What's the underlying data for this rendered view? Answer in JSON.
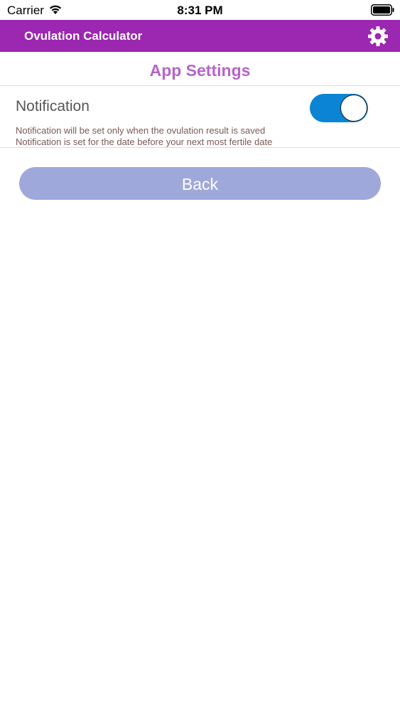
{
  "status_bar": {
    "carrier": "Carrier",
    "time": "8:31 PM",
    "wifi_icon": "wifi-icon",
    "battery_icon": "battery-icon"
  },
  "nav_bar": {
    "title": "Ovulation Calculator",
    "settings_icon": "gear-icon",
    "background_color": "#9c27b0"
  },
  "page": {
    "title": "App Settings",
    "title_color": "#b565c9"
  },
  "notification_setting": {
    "label": "Notification",
    "enabled": true,
    "toggle_color": "#0b84d6",
    "notes": [
      "Notification will be set only when the ovulation result is saved",
      "Notification is set for the date before your next most fertile date"
    ]
  },
  "back_button": {
    "label": "Back",
    "color": "#9fa8da"
  }
}
